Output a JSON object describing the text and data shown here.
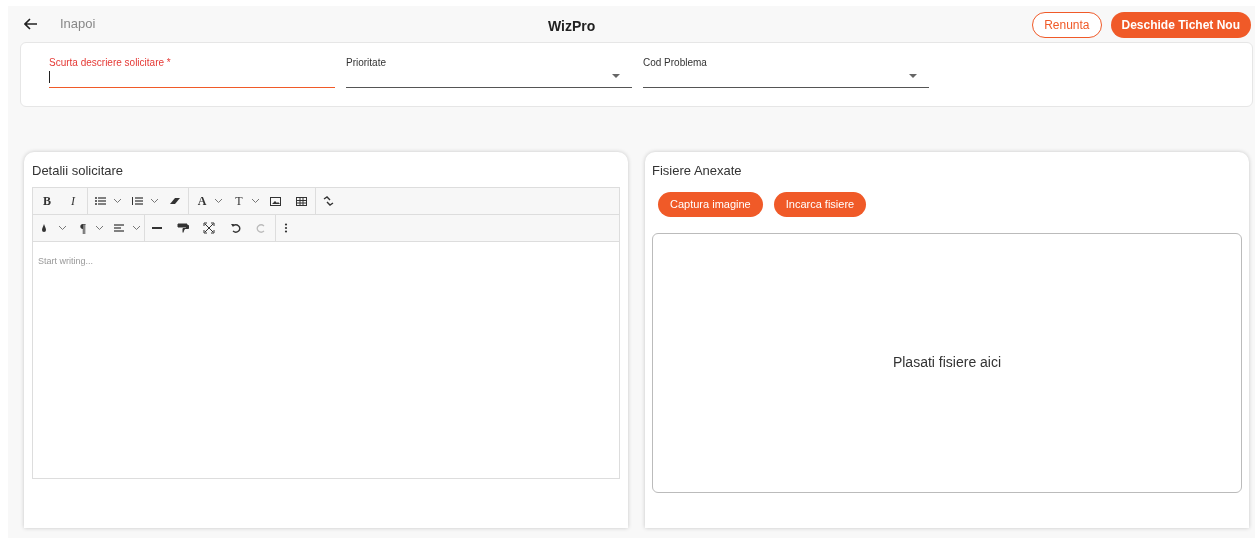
{
  "header": {
    "back_label": "Inapoi",
    "title": "WizPro",
    "buttons": [
      {
        "label": "Renunta",
        "kind": "outline"
      },
      {
        "label": "Deschide Tichet Nou",
        "kind": "filled"
      }
    ]
  },
  "form": {
    "fields": [
      {
        "label": "Scurta descriere solicitare *",
        "kind": "text",
        "focused": true
      },
      {
        "label": "Prioritate",
        "kind": "select",
        "focused": false
      },
      {
        "label": "Cod Problema",
        "kind": "select",
        "focused": false
      }
    ]
  },
  "details": {
    "title": "Detalii solicitare",
    "toolbar_glyphs": [
      "B",
      "I",
      "A",
      "T",
      "¶"
    ],
    "placeholder": "Start writing..."
  },
  "attachments": {
    "title": "Fisiere Anexate",
    "buttons": [
      "Captura imagine",
      "Incarca fisiere"
    ],
    "dropzone": "Plasati fisiere aici"
  }
}
